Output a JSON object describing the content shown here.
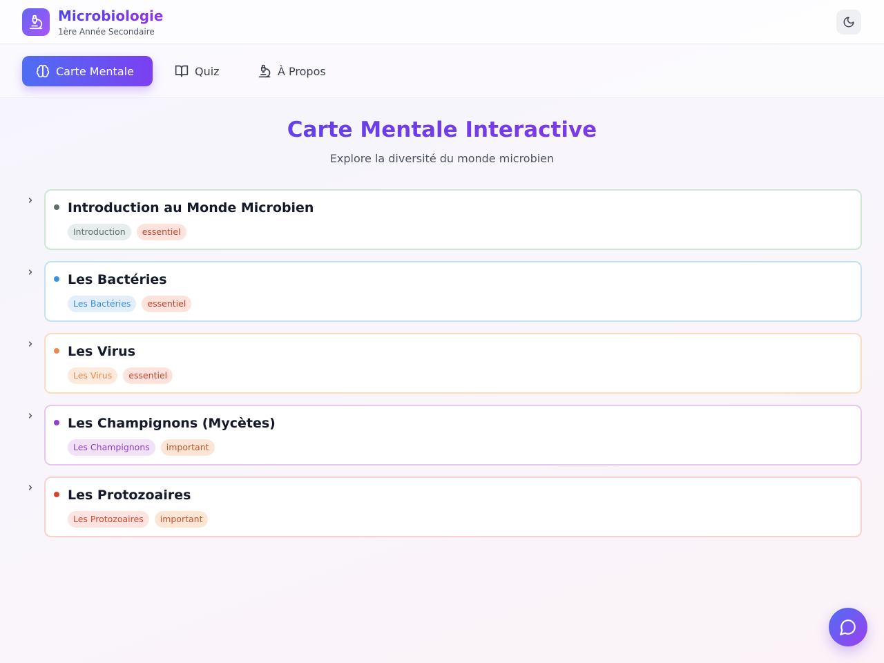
{
  "header": {
    "title": "Microbiologie",
    "subtitle": "1ère Année Secondaire",
    "logo_icon": "microscope-icon",
    "theme_toggle_icon": "moon-icon"
  },
  "nav": {
    "items": [
      {
        "label": "Carte Mentale",
        "icon": "brain-icon",
        "active": true
      },
      {
        "label": "Quiz",
        "icon": "book-open-icon",
        "active": false
      },
      {
        "label": "À Propos",
        "icon": "microscope-icon",
        "active": false
      }
    ]
  },
  "main": {
    "title": "Carte Mentale Interactive",
    "subtitle": "Explore la diversité du monde microbien"
  },
  "topics": [
    {
      "title": "Introduction au Monde Microbien",
      "category": "Introduction",
      "level": "essentiel",
      "color": "#5f6b6b",
      "border": "#cfe6d3"
    },
    {
      "title": "Les Bactéries",
      "category": "Les Bactéries",
      "level": "essentiel",
      "color": "#3b8fdd",
      "border": "#c4e0f4"
    },
    {
      "title": "Les Virus",
      "category": "Les Virus",
      "level": "essentiel",
      "color": "#e8894f",
      "border": "#fbdcbf"
    },
    {
      "title": "Les Champignons (Mycètes)",
      "category": "Les Champignons",
      "level": "important",
      "color": "#8e3fcf",
      "border": "#e4c8ef"
    },
    {
      "title": "Les Protozoaires",
      "category": "Les Protozoaires",
      "level": "important",
      "color": "#d6452f",
      "border": "#fad0cc"
    }
  ],
  "chat_button_icon": "chat-bubble-icon"
}
